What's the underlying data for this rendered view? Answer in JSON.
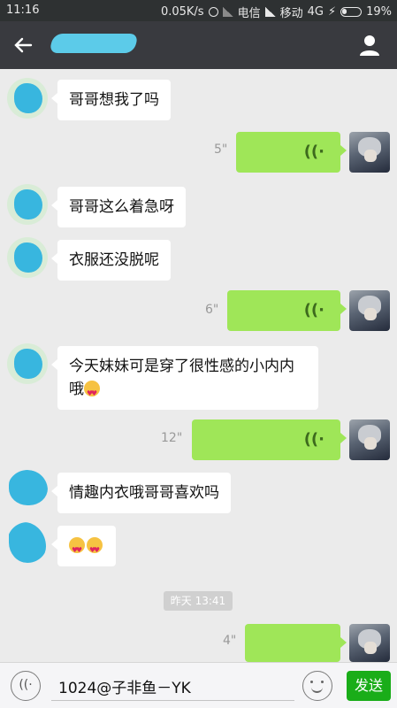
{
  "status_bar": {
    "time": "11:16",
    "speed": "0.05K/s",
    "carrier1": "电信",
    "carrier2": "移动",
    "network": "4G",
    "battery": "19%"
  },
  "header": {
    "back_icon": "arrow-left-icon",
    "profile_icon": "person-icon"
  },
  "messages": [
    {
      "side": "left",
      "text": "哥哥想我了吗"
    },
    {
      "side": "right",
      "type": "voice",
      "duration": "5\""
    },
    {
      "side": "left",
      "text": "哥哥这么着急呀"
    },
    {
      "side": "left",
      "text": "衣服还没脱呢"
    },
    {
      "side": "right",
      "type": "voice",
      "duration": "6\""
    },
    {
      "side": "left",
      "text": "今天妹妹可是穿了很性感的小内内",
      "text2": "哦"
    },
    {
      "side": "right",
      "type": "voice",
      "duration": "12\""
    },
    {
      "side": "left",
      "text": "情趣内衣哦哥哥喜欢吗"
    },
    {
      "side": "left",
      "type": "emoji",
      "emoji": "heart-eyes-emoji x2"
    },
    {
      "side": "right",
      "type": "voice",
      "duration": "4\""
    }
  ],
  "time_separator": "昨天 13:41",
  "input": {
    "value": "1024@子非鱼－YK",
    "send_label": "发送"
  },
  "colors": {
    "header_bg": "#393a3f",
    "chat_bg": "#ebebeb",
    "own_bubble": "#9fe658",
    "send_button": "#1aad19"
  }
}
